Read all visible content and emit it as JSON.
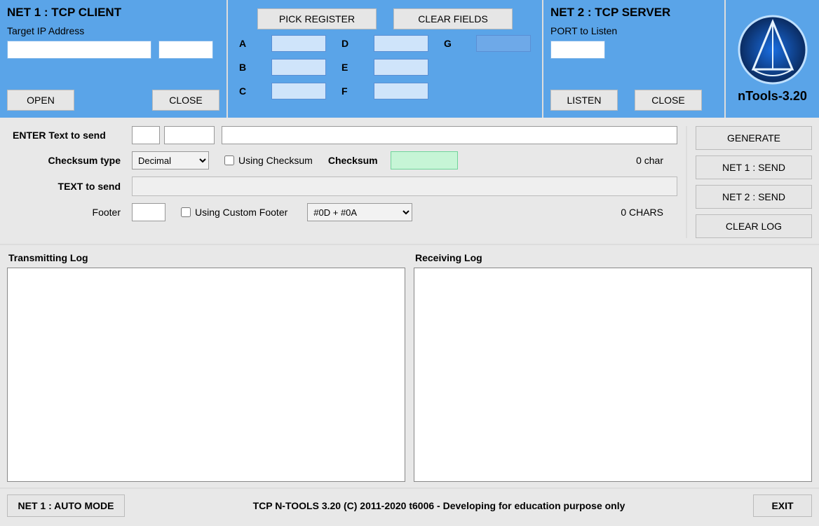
{
  "net1": {
    "title": "NET 1 : TCP CLIENT",
    "ip_label": "Target IP Address",
    "ip_value": "",
    "port_value": "",
    "open_btn": "OPEN",
    "close_btn": "CLOSE"
  },
  "registers": {
    "pick_btn": "PICK REGISTER",
    "clear_btn": "CLEAR FIELDS",
    "labels": {
      "a": "A",
      "b": "B",
      "c": "C",
      "d": "D",
      "e": "E",
      "f": "F",
      "g": "G"
    }
  },
  "net2": {
    "title": "NET 2 : TCP SERVER",
    "port_label": "PORT to Listen",
    "port_value": "",
    "listen_btn": "LISTEN",
    "close_btn": "CLOSE"
  },
  "brand": {
    "title": "nTools-3.20"
  },
  "send": {
    "enter_label": "ENTER Text to send",
    "small1": "",
    "small2": "",
    "text_value": "",
    "checksum_type_label": "Checksum type",
    "checksum_type_value": "Decimal",
    "using_checksum_label": "Using Checksum",
    "checksum_label": "Checksum",
    "checksum_value": "",
    "char_count": "0 char",
    "text_to_send_label": "TEXT to send",
    "footer_label": "Footer",
    "footer_value": "",
    "using_custom_footer_label": "Using Custom Footer",
    "footer_combo_value": "#0D + #0A",
    "chars_count": "0 CHARS"
  },
  "actions": {
    "generate": "GENERATE",
    "net1_send": "NET 1 : SEND",
    "net2_send": "NET 2 : SEND",
    "clear_log": "CLEAR LOG"
  },
  "logs": {
    "tx_title": "Transmitting Log",
    "rx_title": "Receiving Log"
  },
  "footer": {
    "auto_mode": "NET 1 : AUTO MODE",
    "status": "TCP N-TOOLS 3.20 (C) 2011-2020 t6006 - Developing for education purpose only",
    "exit": "EXIT"
  }
}
